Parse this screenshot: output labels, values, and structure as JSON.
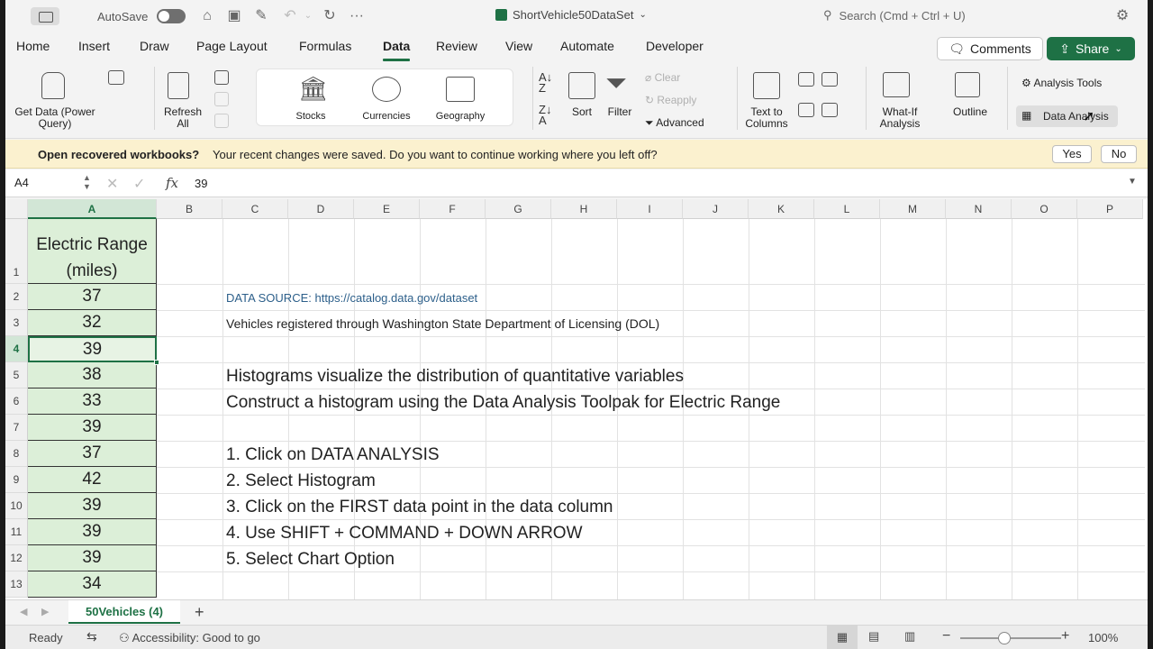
{
  "titlebar": {
    "autosave_label": "AutoSave",
    "doc_title": "ShortVehicle50DataSet",
    "search_placeholder": "Search (Cmd + Ctrl + U)"
  },
  "tabs": [
    "Home",
    "Insert",
    "Draw",
    "Page Layout",
    "Formulas",
    "Data",
    "Review",
    "View",
    "Automate",
    "Developer"
  ],
  "active_tab": "Data",
  "header_buttons": {
    "comments": "Comments",
    "share": "Share"
  },
  "ribbon": {
    "get_data": "Get Data (Power Query)",
    "refresh_all": "Refresh All",
    "stocks": "Stocks",
    "currencies": "Currencies",
    "geography": "Geography",
    "sort": "Sort",
    "filter": "Filter",
    "clear": "Clear",
    "reapply": "Reapply",
    "advanced": "Advanced",
    "text_to_columns": "Text to Columns",
    "what_if": "What-If Analysis",
    "outline": "Outline",
    "analysis_tools": "Analysis Tools",
    "data_analysis": "Data Analysis"
  },
  "message_bar": {
    "title": "Open recovered workbooks?",
    "text": "Your recent changes were saved. Do you want to continue working where you left off?",
    "yes": "Yes",
    "no": "No"
  },
  "formula_bar": {
    "name_box": "A4",
    "fx": "fx",
    "value": "39"
  },
  "columns": [
    "A",
    "B",
    "C",
    "D",
    "E",
    "F",
    "G",
    "H",
    "I",
    "J",
    "K",
    "L",
    "M",
    "N",
    "O",
    "P"
  ],
  "rows": [
    "1",
    "2",
    "3",
    "4",
    "5",
    "6",
    "7",
    "8",
    "9",
    "10",
    "11",
    "12",
    "13"
  ],
  "column_a": {
    "header": "Electric Range (miles)",
    "values": [
      "37",
      "32",
      "39",
      "38",
      "33",
      "39",
      "37",
      "42",
      "39",
      "39",
      "39",
      "34"
    ]
  },
  "notes": {
    "r2": "DATA SOURCE: https://catalog.data.gov/dataset",
    "r3": "Vehicles registered through Washington State Department of Licensing (DOL)",
    "r5": "Histograms visualize the distribution of quantitative variables",
    "r6": "Construct a histogram using the Data Analysis Toolpak for Electric Range",
    "r8": "1. Click on DATA ANALYSIS",
    "r9": "2. Select Histogram",
    "r10": "3. Click on the FIRST data point in the data column",
    "r11": "4. Use SHIFT + COMMAND + DOWN ARROW",
    "r12": "5. Select Chart Option"
  },
  "sheet_tab": "50Vehicles (4)",
  "status": {
    "ready": "Ready",
    "accessibility": "Accessibility: Good to go",
    "zoom": "100%"
  },
  "colors": {
    "accent": "#1e7145",
    "selected_fill": "#dcefd8",
    "message_bg": "#fbf1cf",
    "link_blue": "#2c5f8a"
  }
}
